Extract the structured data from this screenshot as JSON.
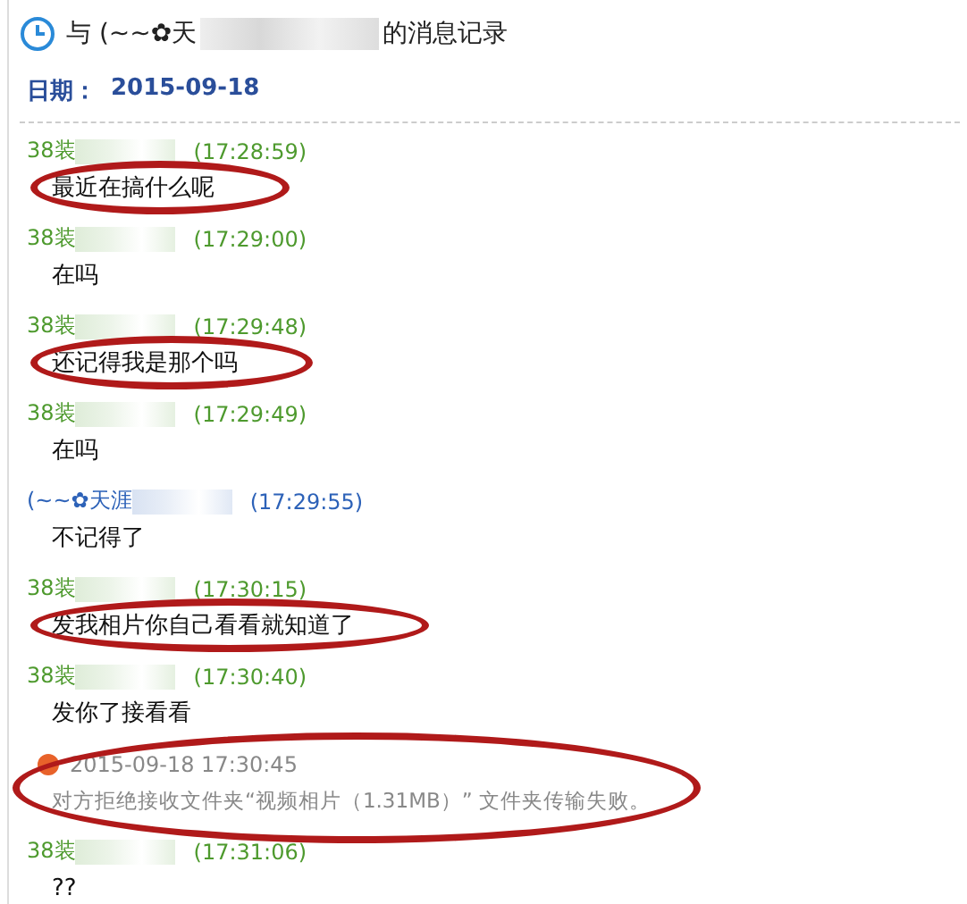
{
  "header": {
    "title_start": "与 (~~✿天",
    "title_end": "的消息记录",
    "date_label": "日期：",
    "date": "2015-09-18"
  },
  "messages": [
    {
      "kind": "message",
      "sender": "38装",
      "color": "#4e9a2e",
      "time": "(17:28:59)",
      "text": "最近在搞什么呢",
      "circled": true
    },
    {
      "kind": "message",
      "sender": "38装",
      "color": "#4e9a2e",
      "time": "(17:29:00)",
      "text": "在吗",
      "circled": false
    },
    {
      "kind": "message",
      "sender": "38装",
      "color": "#4e9a2e",
      "time": "(17:29:48)",
      "text": "还记得我是那个吗",
      "circled": true
    },
    {
      "kind": "message",
      "sender": "38装",
      "color": "#4e9a2e",
      "time": "(17:29:49)",
      "text": "在吗",
      "circled": false
    },
    {
      "kind": "message",
      "sender": "(~~✿天涯",
      "color": "#2d62b8",
      "time": "(17:29:55)",
      "text": "不记得了",
      "circled": false
    },
    {
      "kind": "message",
      "sender": "38装",
      "color": "#4e9a2e",
      "time": "(17:30:15)",
      "text": "发我相片你自己看看就知道了",
      "circled": true
    },
    {
      "kind": "message",
      "sender": "38装",
      "color": "#4e9a2e",
      "time": "(17:30:40)",
      "text": "发你了接看看",
      "circled": false
    },
    {
      "kind": "notice",
      "time": "2015-09-18 17:30:45",
      "text": "对方拒绝接收文件夹“视频相片（1.31MB）” 文件夹传输失败。",
      "circled": true
    },
    {
      "kind": "message",
      "sender": "38装",
      "color": "#4e9a2e",
      "time": "(17:31:06)",
      "text": "??",
      "circled": false
    }
  ]
}
